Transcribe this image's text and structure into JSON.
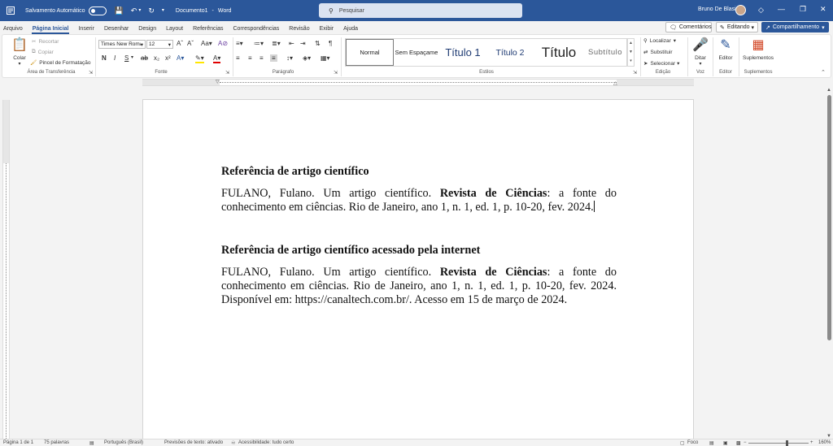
{
  "titlebar": {
    "autosave_label": "Salvamento Automático",
    "doc_title": "Documento1",
    "separator": "-",
    "app_name": "Word",
    "search_placeholder": "Pesquisar",
    "user_name": "Bruno De Blasi",
    "background_color": "#2b579a"
  },
  "tabs": [
    "Arquivo",
    "Página Inicial",
    "Inserir",
    "Desenhar",
    "Design",
    "Layout",
    "Referências",
    "Correspondências",
    "Revisão",
    "Exibir",
    "Ajuda"
  ],
  "active_tab": "Página Inicial",
  "ribbon_buttons": {
    "comments": "Comentários",
    "editing": "Editando",
    "share": "Compartilhamento"
  },
  "clipboard": {
    "paste": "Colar",
    "cut": "Recortar",
    "copy": "Copiar",
    "format_painter": "Pincel de Formatação",
    "group_label": "Área de Transferência"
  },
  "font": {
    "font_name": "Times New Roma",
    "font_size": "12",
    "group_label": "Fonte"
  },
  "paragraph": {
    "group_label": "Parágrafo"
  },
  "styles": {
    "items": [
      "Normal",
      "Sem Espaçame",
      "Título 1",
      "Título 2",
      "Título",
      "Subtítulo"
    ],
    "group_label": "Estilos"
  },
  "editing": {
    "find": "Localizar",
    "replace": "Substituir",
    "select": "Selecionar",
    "group_label": "Edição"
  },
  "voice": {
    "dictate": "Ditar",
    "group_label": "Voz"
  },
  "editor": {
    "editor": "Editor",
    "group_label": "Editor"
  },
  "addins": {
    "label": "Suplementos",
    "group_label": "Suplementos"
  },
  "document": {
    "heading1": "Referência de artigo científico",
    "para1_part1": "FULANO, Fulano. Um artigo científico. ",
    "para1_bold": "Revista de Ciências",
    "para1_part2": ": a fonte do conhecimento em ciências. Rio de Janeiro, ano 1, n. 1, ed. 1, p. 10-20, fev. 2024.",
    "heading2": "Referência de artigo científico acessado pela internet",
    "para2_part1": "FULANO, Fulano. Um artigo científico. ",
    "para2_bold": "Revista de Ciências",
    "para2_part2": ": a fonte do conhecimento em ciências. Rio de Janeiro, ano 1, n. 1, ed. 1, p. 10-20, fev. 2024. Disponível em: https://canaltech.com.br/. Acesso em 15 de março de 2024."
  },
  "statusbar": {
    "page": "Página 1 de 1",
    "words": "75 palavras",
    "language": "Português (Brasil)",
    "text_predictions": "Previsões de texto: ativado",
    "accessibility": "Acessibilidade: tudo certo",
    "focus": "Foco",
    "zoom": "160%"
  }
}
